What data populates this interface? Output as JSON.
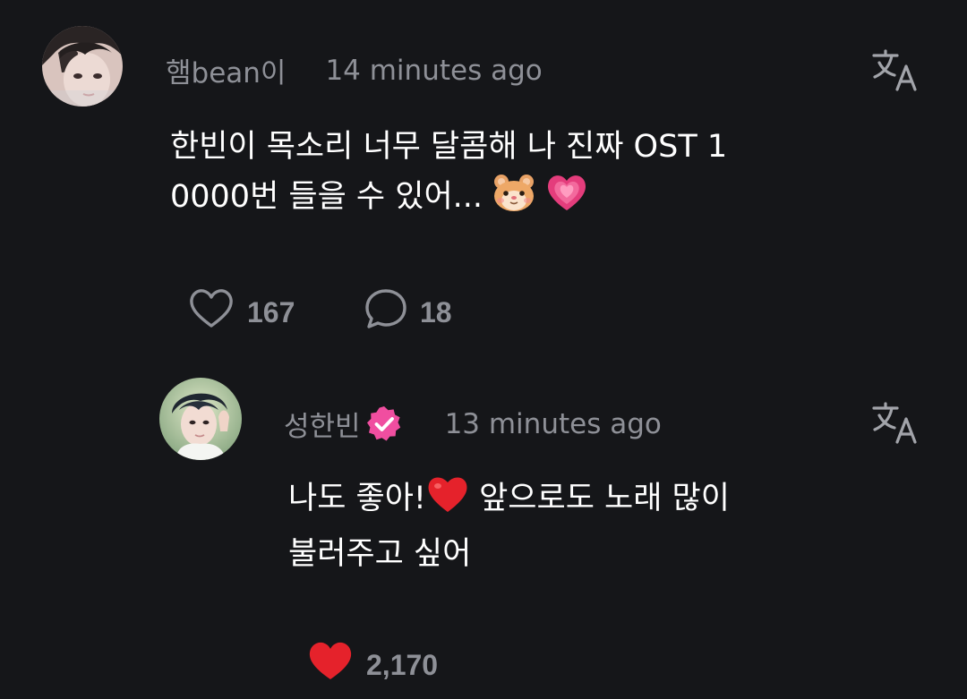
{
  "comment": {
    "username": "햄bean이",
    "time": "14 minutes ago",
    "body_line1": "한빈이 목소리 너무 달콤해 나 진짜 OST 1",
    "body_line2": "0000번 들을 수 있어...",
    "emojis": [
      "hamster-face",
      "growing-heart"
    ],
    "likes": "167",
    "replies": "18"
  },
  "reply": {
    "username": "성한빈",
    "verified": true,
    "time": "13 minutes ago",
    "body_part1": "나도 좋아!",
    "body_part2": " 앞으로도 노래 많이",
    "body_line2": "불러주고 싶어",
    "emojis": [
      "red-heart"
    ],
    "likes": "2,170"
  },
  "colors": {
    "background": "#151619",
    "text": "#ffffff",
    "muted": "#8e9097",
    "verified_badge": "#f04ea0",
    "like_active": "#e5222b"
  }
}
